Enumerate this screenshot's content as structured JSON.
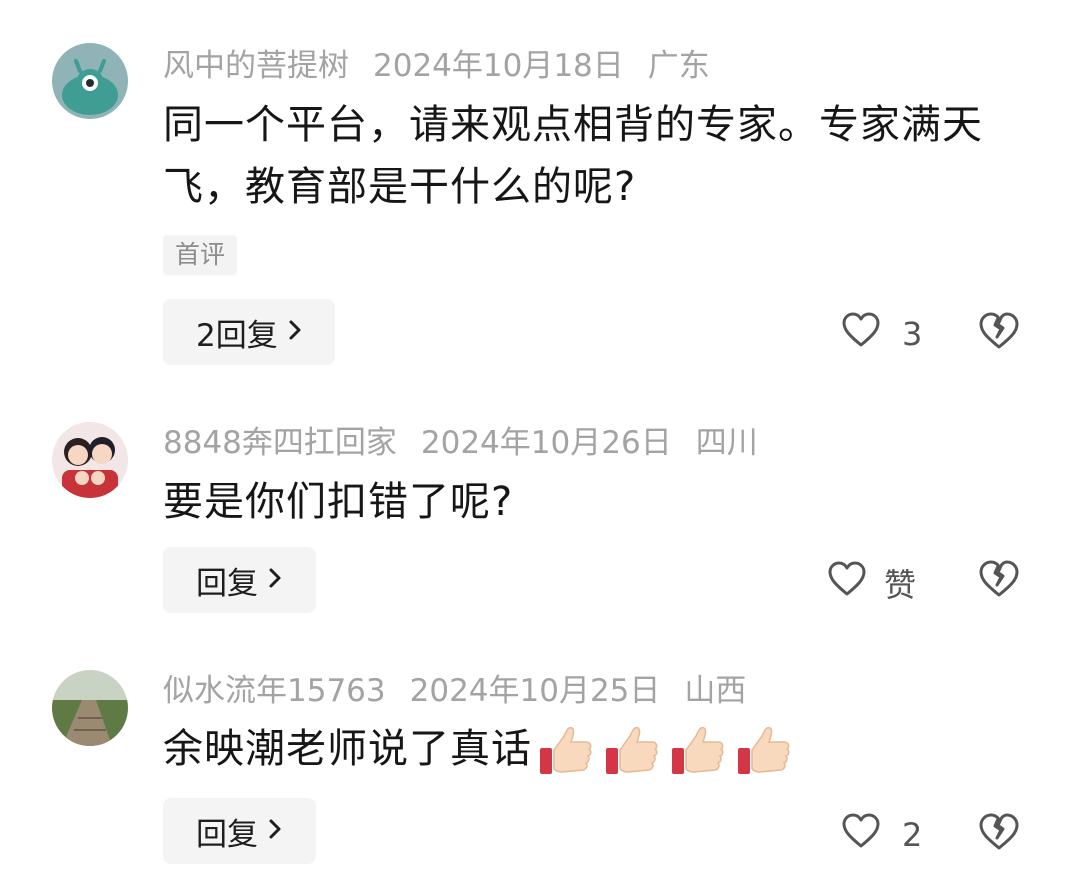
{
  "comments": [
    {
      "user": "风中的菩提树",
      "date": "2024年10月18日",
      "region": "广东",
      "text": "同一个平台，请来观点相背的专家。专家满天飞，教育部是干什么的呢?",
      "tag": "首评",
      "reply_label": "2回复",
      "like_label": "3",
      "avatar_icon": "alien-avatar"
    },
    {
      "user": "8848奔四扛回家",
      "date": "2024年10月26日",
      "region": "四川",
      "text": "要是你们扣错了呢?",
      "reply_label": "回复",
      "like_label": "赞",
      "avatar_icon": "family-cartoon-avatar"
    },
    {
      "user": "似水流年15763",
      "date": "2024年10月25日",
      "region": "山西",
      "text": "余映潮老师说了真话",
      "emoji_icons": [
        "thumbs-up-icon",
        "thumbs-up-icon",
        "thumbs-up-icon",
        "thumbs-up-icon"
      ],
      "reply_label": "回复",
      "like_label": "2",
      "avatar_icon": "landscape-boardwalk-avatar"
    }
  ],
  "colors": {
    "meta": "#a3a3a3",
    "text": "#161616",
    "button_bg": "#f4f4f4",
    "icon": "#555555"
  }
}
